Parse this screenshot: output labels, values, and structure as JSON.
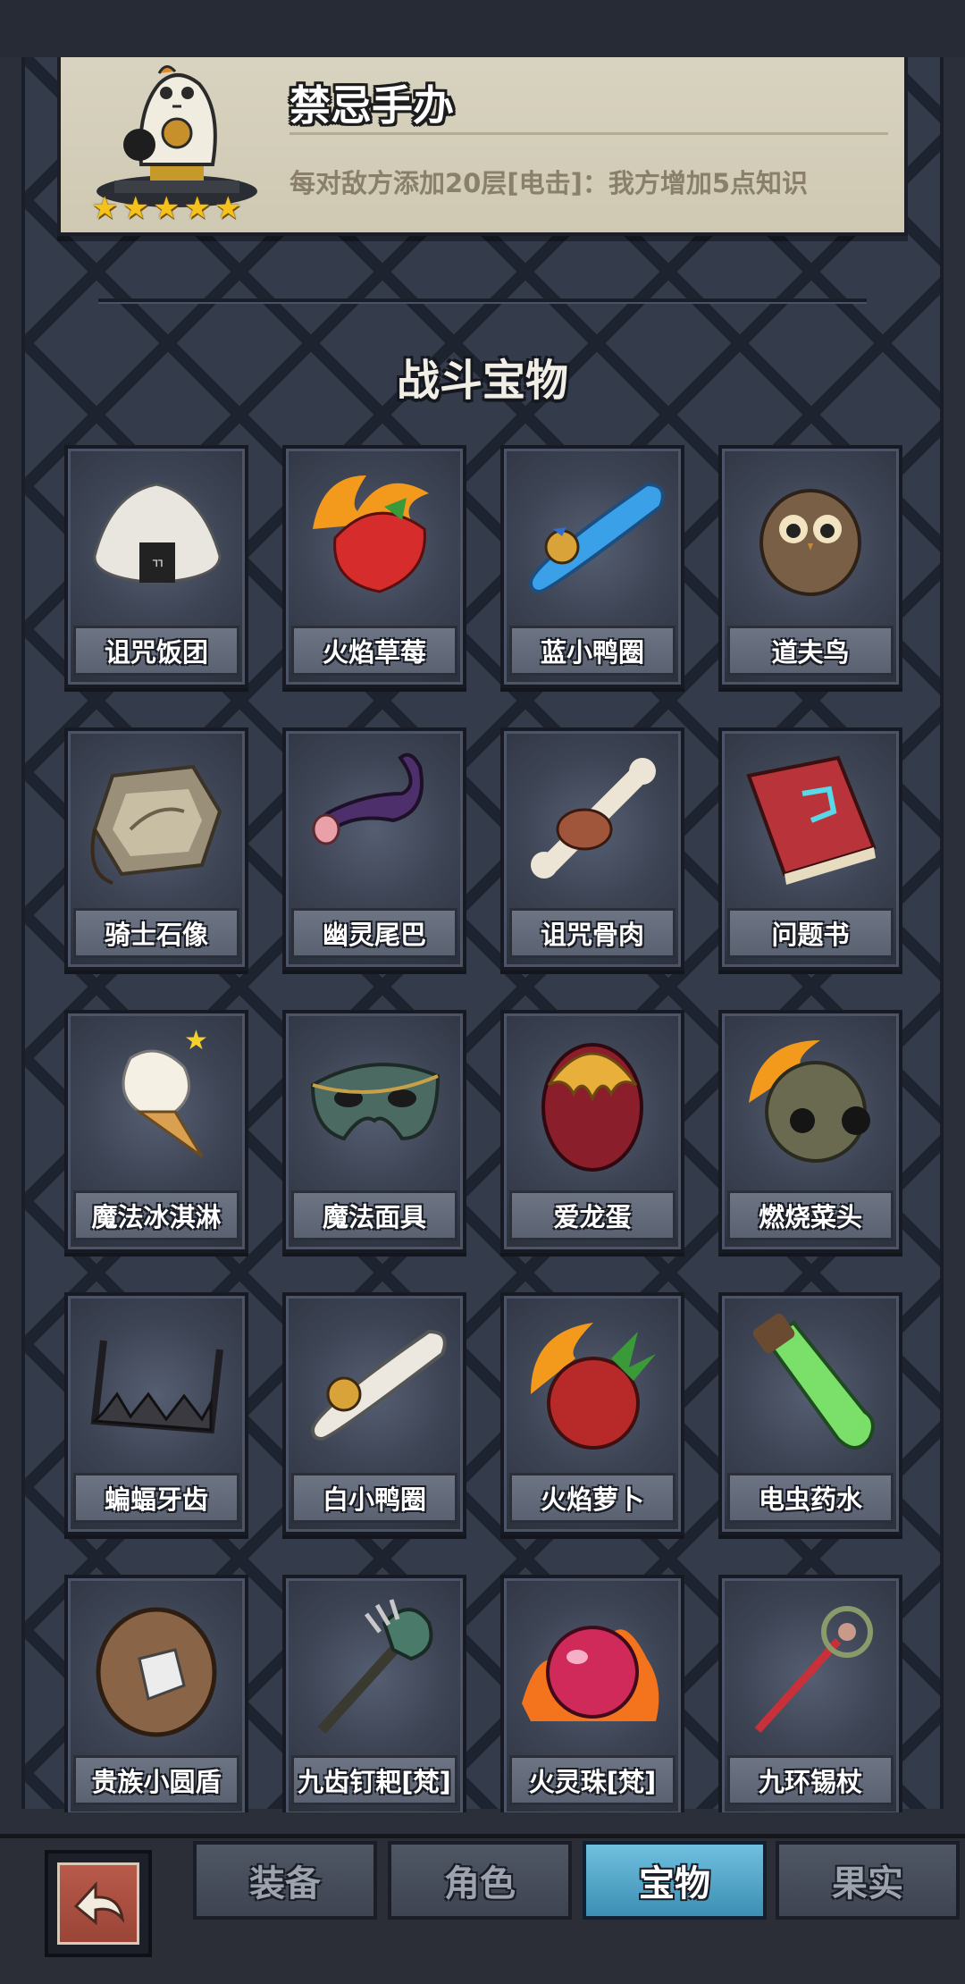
{
  "header": {
    "title": "禁忌手办",
    "description": "每对敌方添加20层[电击]：我方增加5点知识",
    "stars": "★★★★★"
  },
  "section_title": "战斗宝物",
  "items": [
    {
      "label": "诅咒饭团"
    },
    {
      "label": "火焰草莓"
    },
    {
      "label": "蓝小鸭圈"
    },
    {
      "label": "道夫鸟"
    },
    {
      "label": "骑士石像"
    },
    {
      "label": "幽灵尾巴"
    },
    {
      "label": "诅咒骨肉"
    },
    {
      "label": "问题书"
    },
    {
      "label": "魔法冰淇淋"
    },
    {
      "label": "魔法面具"
    },
    {
      "label": "爱龙蛋"
    },
    {
      "label": "燃烧菜头"
    },
    {
      "label": "蝙蝠牙齿"
    },
    {
      "label": "白小鸭圈"
    },
    {
      "label": "火焰萝卜"
    },
    {
      "label": "电虫药水"
    },
    {
      "label": "贵族小圆盾"
    },
    {
      "label": "九齿钉耙[梵]"
    },
    {
      "label": "火灵珠[梵]"
    },
    {
      "label": "九环锡杖"
    }
  ],
  "tabs": [
    {
      "label": "装备",
      "active": false
    },
    {
      "label": "角色",
      "active": false
    },
    {
      "label": "宝物",
      "active": true
    },
    {
      "label": "果实",
      "active": false
    }
  ],
  "colors": {
    "star": "#f5c21b",
    "active_tab": "#4aa3c8"
  }
}
